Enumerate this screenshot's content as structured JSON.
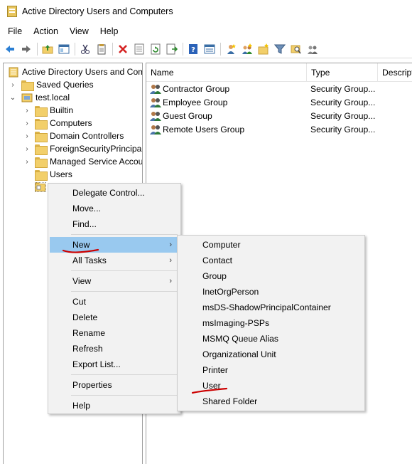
{
  "window": {
    "title": "Active Directory Users and Computers"
  },
  "menubar": [
    "File",
    "Action",
    "View",
    "Help"
  ],
  "toolbar": {
    "buttons": [
      "back-icon",
      "forward-icon",
      "up-folder-icon",
      "show-hide-tree-icon",
      "cut-icon",
      "copy-icon",
      "delete-icon",
      "properties-icon",
      "refresh-icon",
      "export-icon",
      "help-icon",
      "details-view-icon",
      "create-user-icon",
      "create-group-icon",
      "create-ou-icon",
      "filter-icon",
      "find-icon",
      "delegate-icon"
    ]
  },
  "tree": {
    "root": "Active Directory Users and Com",
    "saved_queries": "Saved Queries",
    "domain": "test.local",
    "children": [
      "Builtin",
      "Computers",
      "Domain Controllers",
      "ForeignSecurityPrincipals",
      "Managed Service Accour",
      "Users"
    ],
    "selected_label": ""
  },
  "list": {
    "columns": [
      "Name",
      "Type",
      "Descript"
    ],
    "rows": [
      {
        "name": "Contractor Group",
        "type": "Security Group..."
      },
      {
        "name": "Employee Group",
        "type": "Security Group..."
      },
      {
        "name": "Guest Group",
        "type": "Security Group..."
      },
      {
        "name": "Remote Users Group",
        "type": "Security Group..."
      }
    ]
  },
  "context_menu": {
    "items": [
      "Delegate Control...",
      "Move...",
      "Find...",
      "New",
      "All Tasks",
      "View",
      "Cut",
      "Delete",
      "Rename",
      "Refresh",
      "Export List...",
      "Properties",
      "Help"
    ],
    "highlighted": "New"
  },
  "submenu_new": {
    "items": [
      "Computer",
      "Contact",
      "Group",
      "InetOrgPerson",
      "msDS-ShadowPrincipalContainer",
      "msImaging-PSPs",
      "MSMQ Queue Alias",
      "Organizational Unit",
      "Printer",
      "User",
      "Shared Folder"
    ]
  },
  "colors": {
    "highlight": "#99c9ef",
    "annotation": "#cc0000",
    "folder": "#f2cf6a"
  }
}
